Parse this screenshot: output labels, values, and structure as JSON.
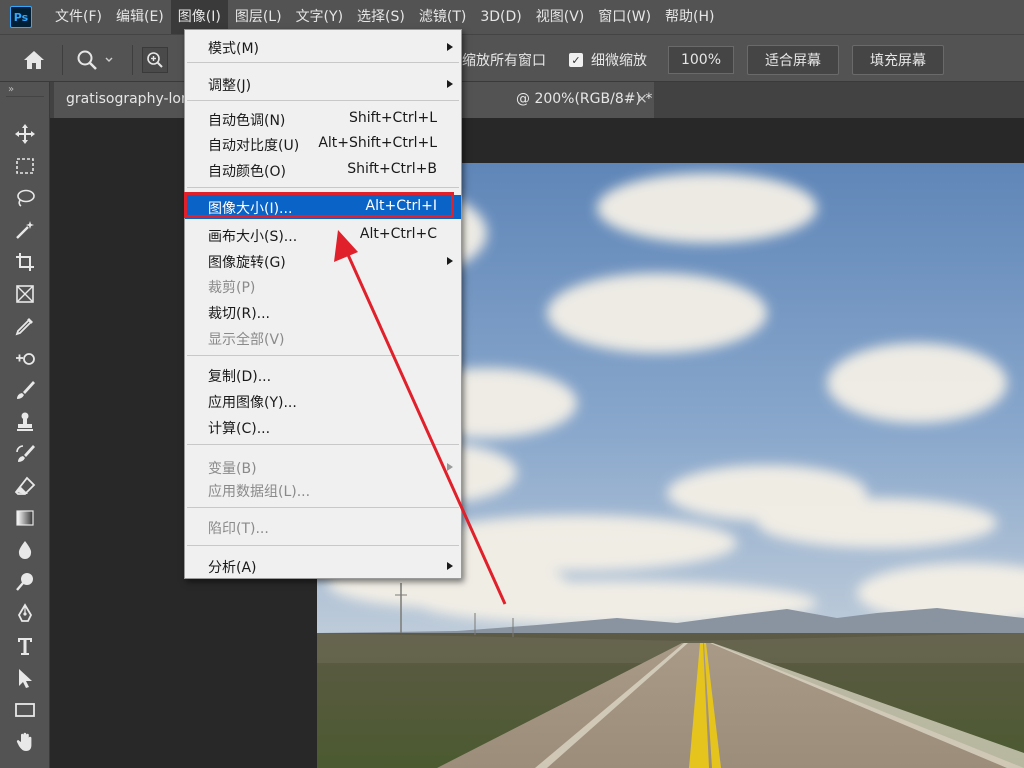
{
  "app": {
    "logo": "Ps"
  },
  "menubar": {
    "items": [
      "文件(F)",
      "编辑(E)",
      "图像(I)",
      "图层(L)",
      "文字(Y)",
      "选择(S)",
      "滤镜(T)",
      "3D(D)",
      "视图(V)",
      "窗口(W)",
      "帮助(H)"
    ],
    "active_index": 2
  },
  "options": {
    "partial_label": "缩放所有窗口",
    "scrubby_label": "细微缩放",
    "scrubby_checked": true,
    "zoom_value": "100%",
    "fit_screen": "适合屏幕",
    "fill_screen": "填充屏幕"
  },
  "document": {
    "tab_name": "gratisography-lon",
    "tab_suffix": "@ 200%(RGB/8#) *",
    "close_glyph": "×"
  },
  "image_menu": {
    "items": [
      {
        "label": "模式(M)",
        "shortcut": "",
        "submenu": true,
        "disabled": false
      },
      {
        "label": "调整(J)",
        "shortcut": "",
        "submenu": true,
        "disabled": false
      },
      {
        "label": "自动色调(N)",
        "shortcut": "Shift+Ctrl+L",
        "submenu": false,
        "disabled": false
      },
      {
        "label": "自动对比度(U)",
        "shortcut": "Alt+Shift+Ctrl+L",
        "submenu": false,
        "disabled": false
      },
      {
        "label": "自动颜色(O)",
        "shortcut": "Shift+Ctrl+B",
        "submenu": false,
        "disabled": false
      },
      {
        "label": "图像大小(I)...",
        "shortcut": "Alt+Ctrl+I",
        "submenu": false,
        "disabled": false,
        "highlighted": true
      },
      {
        "label": "画布大小(S)...",
        "shortcut": "Alt+Ctrl+C",
        "submenu": false,
        "disabled": false
      },
      {
        "label": "图像旋转(G)",
        "shortcut": "",
        "submenu": true,
        "disabled": false
      },
      {
        "label": "裁剪(P)",
        "shortcut": "",
        "submenu": false,
        "disabled": true
      },
      {
        "label": "裁切(R)...",
        "shortcut": "",
        "submenu": false,
        "disabled": false
      },
      {
        "label": "显示全部(V)",
        "shortcut": "",
        "submenu": false,
        "disabled": true
      },
      {
        "label": "复制(D)...",
        "shortcut": "",
        "submenu": false,
        "disabled": false
      },
      {
        "label": "应用图像(Y)...",
        "shortcut": "",
        "submenu": false,
        "disabled": false
      },
      {
        "label": "计算(C)...",
        "shortcut": "",
        "submenu": false,
        "disabled": false
      },
      {
        "label": "变量(B)",
        "shortcut": "",
        "submenu": true,
        "disabled": true
      },
      {
        "label": "应用数据组(L)...",
        "shortcut": "",
        "submenu": false,
        "disabled": true
      },
      {
        "label": "陷印(T)...",
        "shortcut": "",
        "submenu": false,
        "disabled": true
      },
      {
        "label": "分析(A)",
        "shortcut": "",
        "submenu": true,
        "disabled": false
      }
    ]
  },
  "tools": [
    "move-tool-icon",
    "marquee-tool-icon",
    "lasso-tool-icon",
    "magic-wand-icon",
    "crop-tool-icon",
    "frame-tool-icon",
    "eyedropper-icon",
    "healing-brush-icon",
    "brush-tool-icon",
    "clone-stamp-icon",
    "history-brush-icon",
    "eraser-icon",
    "gradient-tool-icon",
    "blur-tool-icon",
    "dodge-tool-icon",
    "pen-tool-icon",
    "type-tool-icon",
    "path-selection-icon",
    "rectangle-tool-icon",
    "hand-tool-icon"
  ],
  "colors": {
    "highlight": "#0a64c8",
    "annotation": "#e0202a",
    "panel": "#535353"
  }
}
